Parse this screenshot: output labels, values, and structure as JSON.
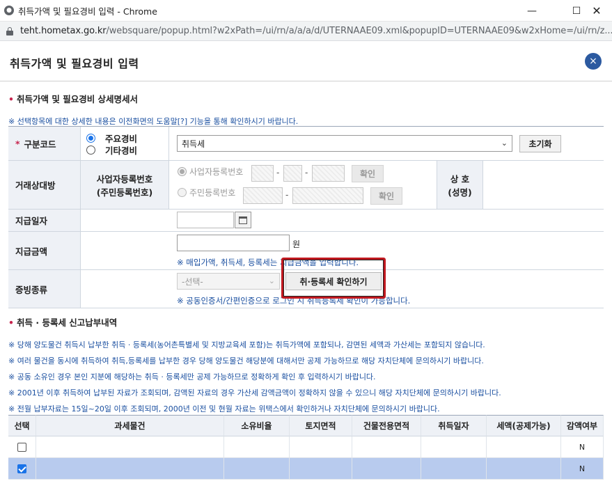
{
  "window": {
    "title": "취득가액 및 필요경비 입력 - Chrome",
    "url_host": "teht.hometax.go.kr",
    "url_path": "/websquare/popup.html?w2xPath=/ui/rn/a/a/a/d/UTERNAAE09.xml&popupID=UTERNAAE09&w2xHome=/ui/rn/z..."
  },
  "popup": {
    "title": "취득가액 및 필요경비 입력",
    "close_label": "×"
  },
  "section1": {
    "title": "취득가액 및 필요경비 상세명세서",
    "notice": "※ 선택항목에 대한 상세한 내용은 이전화면의 도움말[?] 기능을 통해 확인하시기 바랍니다."
  },
  "form": {
    "code": {
      "label": "구분코드",
      "required_mark": "*",
      "radio_main": "주요경비",
      "radio_other": "기타경비",
      "selected": "주요경비",
      "select_value": "취득세",
      "reset_button": "초기화"
    },
    "counterparty": {
      "label": "거래상대방",
      "sublabel_line1": "사업자등록번호",
      "sublabel_line2": "(주민등록번호)",
      "biz_radio": "사업자등록번호",
      "resident_radio": "주민등록번호",
      "confirm_button": "확인",
      "name_label_line1": "상 호",
      "name_label_line2": "(성명)",
      "dash": "-"
    },
    "pay_date": {
      "label": "지급일자"
    },
    "pay_amount": {
      "label": "지급금액",
      "unit": "원",
      "hint": "※ 매입가액, 취득세, 등록세는 지급금액을 입력합니다."
    },
    "proof": {
      "label": "증빙종류",
      "select_placeholder": "-선택-",
      "check_button": "취·등록세 확인하기",
      "hint": "※ 공동인증서/간편인증으로 로그인 시 취득등록세 확인이 가능합니다."
    }
  },
  "section2": {
    "title": "취득 · 등록세 신고납부내역",
    "notices": [
      "※ 당해 양도물건 취득시 납부한 취득 · 등록세(농어촌특별세 및 지방교육세 포함)는 취득가액에 포함되나, 감면된 세액과 가산세는 포함되지 않습니다.",
      "※ 여러 물건을 동시에 취득하여 취득,등록세를 납부한 경우 당해 양도물건 해당분에 대해서만 공제 가능하므로 해당 자치단체에 문의하시기 바랍니다.",
      "※ 공동 소유인 경우 본인 지분에 해당하는 취득 · 등록세만 공제 가능하므로 정확하게 확인 후 입력하시기 바랍니다.",
      "※ 2001년 이후 취득하여 납부된 자료가 조회되며, 감액된 자료의 경우 가산세 감액금액이 정확하지 않을 수 있으니 해당 자치단체에 문의하시기 바랍니다.",
      "※ 전월 납부자료는 15일~20일 이후 조회되며, 2000년 이전 및 현월 자료는 위택스에서 확인하거나 자치단체에 문의하시기 바랍니다."
    ]
  },
  "grid": {
    "columns": [
      "선택",
      "과세물건",
      "소유비율",
      "토지면적",
      "건물전용면적",
      "취득일자",
      "세액(공제가능)",
      "감액여부"
    ],
    "rows": [
      {
        "checked": false,
        "reduced": "N"
      },
      {
        "checked": true,
        "reduced": "N"
      }
    ]
  }
}
